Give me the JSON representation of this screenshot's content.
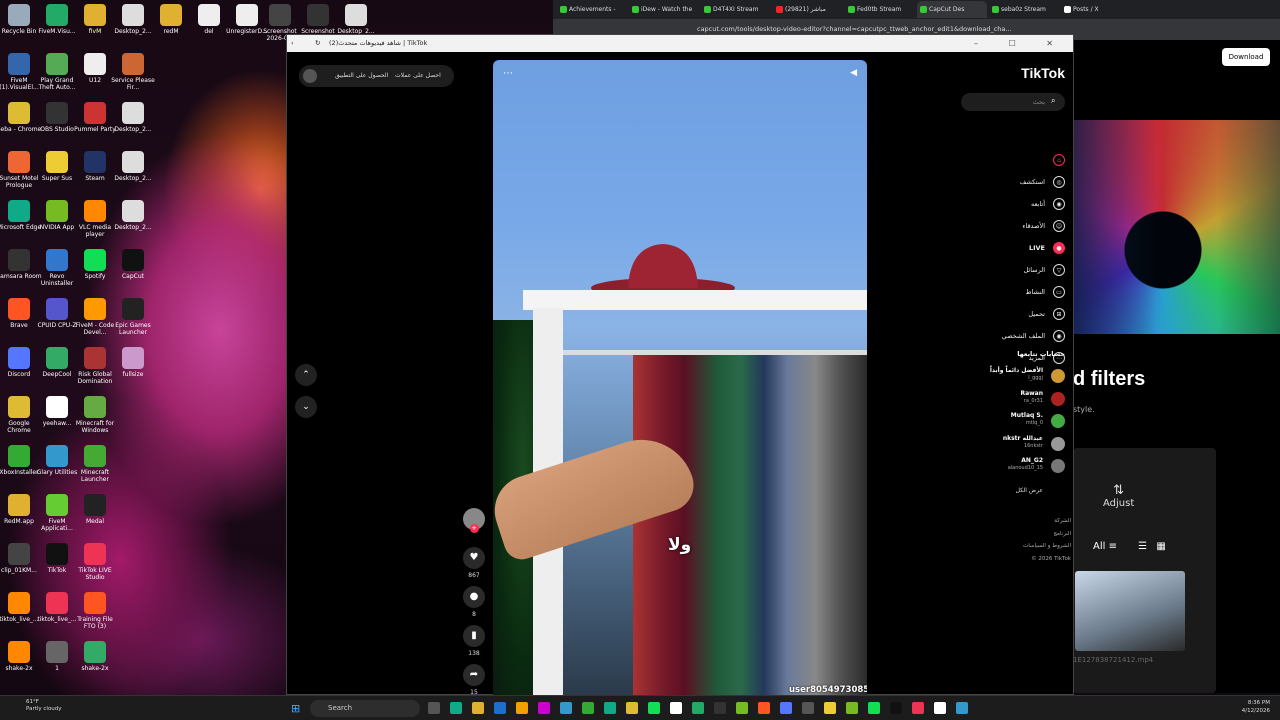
{
  "desktop": {
    "icons": [
      {
        "label": "Recycle Bin",
        "color": "#9ab"
      },
      {
        "label": "FiveM.Visu...",
        "color": "#2a6"
      },
      {
        "label": "fivM",
        "color": "#e0b030"
      },
      {
        "label": "Desktop_2...",
        "color": "#ddd"
      },
      {
        "label": "redM",
        "color": "#e0b030"
      },
      {
        "label": "del",
        "color": "#eee"
      },
      {
        "label": "UnregisterD...",
        "color": "#eee"
      },
      {
        "label": "Screenshot 2026-0...",
        "color": "#444"
      },
      {
        "label": "Screenshot 2026-01-27",
        "color": "#333"
      },
      {
        "label": "Desktop_2...",
        "color": "#ddd"
      },
      {
        "label": "FiveM (1).VisualEl...",
        "color": "#36a"
      },
      {
        "label": "Play Grand Theft Auto...",
        "color": "#5a5"
      },
      {
        "label": "U12",
        "color": "#eee"
      },
      {
        "label": "Service Please Fir...",
        "color": "#c63"
      },
      {
        "label": "Seba - Chrome",
        "color": "#db3"
      },
      {
        "label": "OBS Studio",
        "color": "#333"
      },
      {
        "label": "Pummel Party",
        "color": "#c33"
      },
      {
        "label": "Desktop_2...",
        "color": "#ddd"
      },
      {
        "label": "Sunset Motel Prologue",
        "color": "#e63"
      },
      {
        "label": "Super Sus",
        "color": "#ec3"
      },
      {
        "label": "Steam",
        "color": "#236"
      },
      {
        "label": "Desktop_2...",
        "color": "#ddd"
      },
      {
        "label": "Microsoft Edge",
        "color": "#1a8"
      },
      {
        "label": "NVIDIA App",
        "color": "#7b2"
      },
      {
        "label": "VLC media player",
        "color": "#f80"
      },
      {
        "label": "Desktop_2...",
        "color": "#ddd"
      },
      {
        "label": "Samsara Room",
        "color": "#333"
      },
      {
        "label": "Revo Uninstaller",
        "color": "#37c"
      },
      {
        "label": "Spotify",
        "color": "#1d5"
      },
      {
        "label": "CapCut",
        "color": "#111"
      },
      {
        "label": "Brave",
        "color": "#f52"
      },
      {
        "label": "CPUID CPU-Z",
        "color": "#55c"
      },
      {
        "label": "FiveM - Code Devel...",
        "color": "#f90"
      },
      {
        "label": "Epic Games Launcher",
        "color": "#222"
      },
      {
        "label": "Discord",
        "color": "#57f"
      },
      {
        "label": "DeepCool",
        "color": "#3a6"
      },
      {
        "label": "Risk Global Domination",
        "color": "#a33"
      },
      {
        "label": "fullsize",
        "color": "#c9c"
      },
      {
        "label": "Google Chrome",
        "color": "#db3"
      },
      {
        "label": "yeehaw...",
        "color": "#fff"
      },
      {
        "label": "Minecraft for Windows",
        "color": "#6a4"
      },
      {
        "label": "XboxInstaller",
        "color": "#3a3"
      },
      {
        "label": "Glary Utilities",
        "color": "#39c"
      },
      {
        "label": "Minecraft Launcher",
        "color": "#4a3"
      },
      {
        "label": "RedM.app",
        "color": "#e0b030"
      },
      {
        "label": "FiveM Applicati...",
        "color": "#6c3"
      },
      {
        "label": "Medal",
        "color": "#222"
      },
      {
        "label": "clip_01KM...",
        "color": "#444"
      },
      {
        "label": "TikTok",
        "color": "#111"
      },
      {
        "label": "TikTok LIVE Studio",
        "color": "#e35"
      },
      {
        "label": "tiktok_live_...",
        "color": "#f80"
      },
      {
        "label": "tiktok_live_...",
        "color": "#e35"
      },
      {
        "label": "Training File FTO (3)",
        "color": "#f52"
      },
      {
        "label": "shake-2x",
        "color": "#f80"
      },
      {
        "label": "1",
        "color": "#666"
      },
      {
        "label": "shake-2x",
        "color": "#3a6"
      }
    ]
  },
  "bg_browser": {
    "tabs": [
      "Achievements -",
      "iDew - Watch the",
      "D4T4XI Stream",
      "مباشر (29821)",
      "Fed0tb Stream",
      "CapCut Des",
      "seba0z Stream",
      "Posts / X"
    ],
    "url": "capcut.com/tools/desktop-video-editor?channel=capcutpc_ttweb_anchor_edit1&download_cha...",
    "download": "Download",
    "filters_title": "d filters",
    "style_text": "style.",
    "adjust": "Adjust",
    "all": "All",
    "file": "1E127838721412.mp4"
  },
  "tiktok": {
    "window_title": "شاهد فيديوهات متحدث(2) | TikTok",
    "top_left_btn": "احصل على عملات",
    "top_left_btn2": "الحصول على التطبيق",
    "logo": "TikTok",
    "search_placeholder": "بحث",
    "nav": [
      "",
      "استكشف",
      "أتابعه",
      "الأصدقاء",
      "LIVE",
      "الرسائل",
      "النشاط",
      "تحميل",
      "الملف الشخصي",
      "المزيد"
    ],
    "following_heading": "حسابات تتابعها",
    "accounts": [
      {
        "name": "الأفضل دائماً وأبداً",
        "handle": "l_gggj",
        "color": "#c93"
      },
      {
        "name": "Rawan",
        "handle": "ra_0r31",
        "color": "#a22"
      },
      {
        "name": "Mutlaq S.",
        "handle": "mtlq_0",
        "color": "#4a4"
      },
      {
        "name": "nkstr عبدالله",
        "handle": "16nkstr",
        "color": "#999"
      },
      {
        "name": "AN_G2",
        "handle": "alanoud10_15",
        "color": "#777"
      }
    ],
    "see_all": "عرض الكل",
    "footer": [
      "الشركة",
      "البرنامج",
      "الشروط و السياسات",
      "© 2026 TikTok"
    ],
    "video": {
      "sticker": "ولا",
      "username": "user8054973085"
    },
    "actions": {
      "likes": "867",
      "comments": "8",
      "saves": "138",
      "shares": "15"
    }
  },
  "taskbar": {
    "weather_temp": "61°F",
    "weather_desc": "Partly cloudy",
    "search": "Search",
    "time": "8:36 PM",
    "date": "4/12/2026"
  },
  "colors": {
    "tiktok_pink": "#fe2c55",
    "taskbar": "#1c1c1c"
  }
}
